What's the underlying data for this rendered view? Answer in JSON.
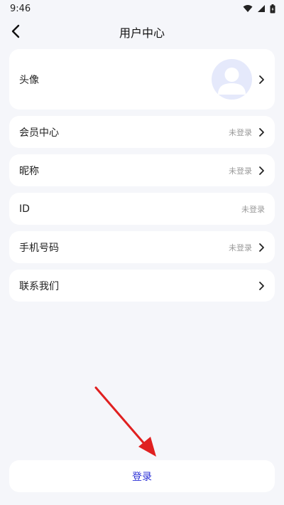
{
  "status": {
    "time": "9:46"
  },
  "header": {
    "title": "用户中心"
  },
  "rows": [
    {
      "label": "头像",
      "value": ""
    },
    {
      "label": "会员中心",
      "value": "未登录"
    },
    {
      "label": "昵称",
      "value": "未登录"
    },
    {
      "label": "ID",
      "value": "未登录"
    },
    {
      "label": "手机号码",
      "value": "未登录"
    },
    {
      "label": "联系我们",
      "value": ""
    }
  ],
  "login": {
    "label": "登录"
  },
  "colors": {
    "accent": "#2a2fd6",
    "annotation_arrow": "#e02020",
    "background": "#f5f6fa"
  }
}
